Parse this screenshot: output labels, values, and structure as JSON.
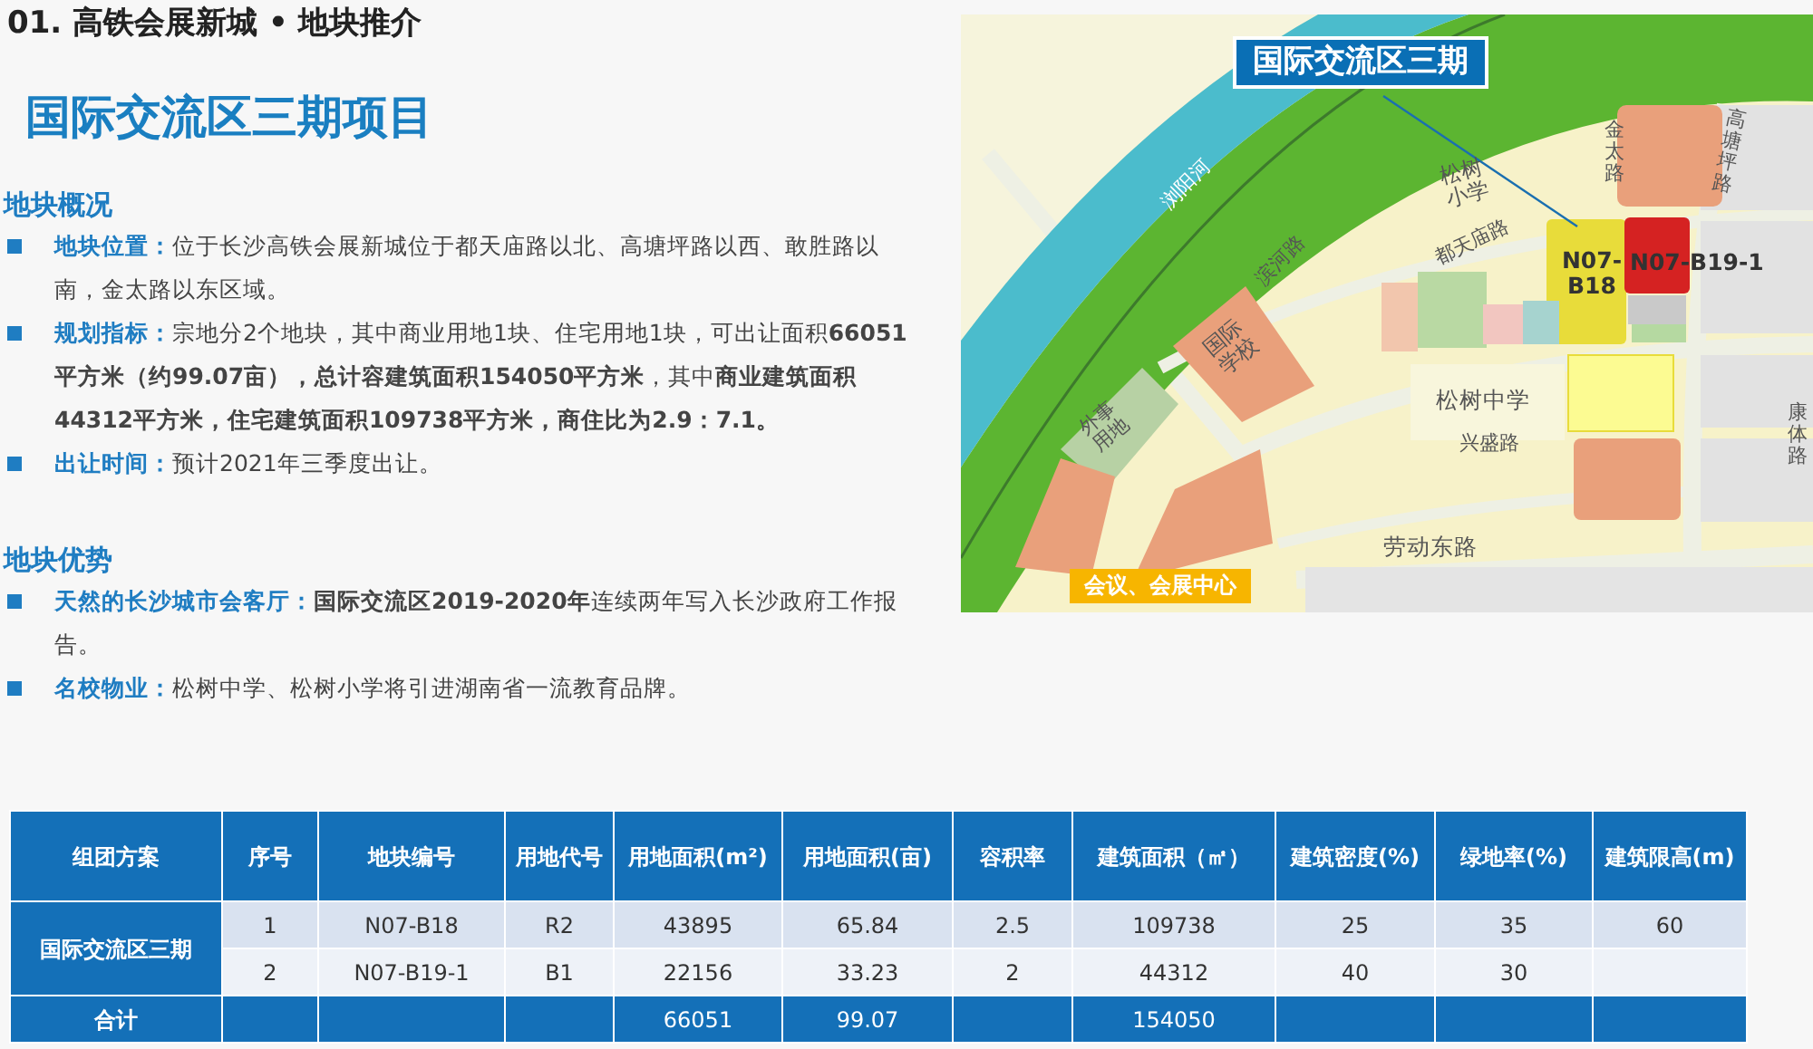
{
  "header": {
    "section_title": "01. 高铁会展新城 • 地块推介",
    "project_title": "国际交流区三期项目"
  },
  "overview": {
    "heading": "地块概况",
    "items": [
      {
        "label": "地块位置：",
        "text": "位于长沙高铁会展新城位于都天庙路以北、高塘坪路以西、敢胜路以南，金太路以东区域。"
      },
      {
        "label": "规划指标：",
        "text": "宗地分2个地块，其中商业用地1块、住宅用地1块，可出让面积**66051平方米（约99.07亩），总计容建筑面积154050平方米**，其中**商业建筑面积44312平方米，住宅建筑面积109738平方米，商住比为2.9：7.1。**"
      },
      {
        "label": "出让时间：",
        "text": "预计2021年三季度出让。"
      }
    ]
  },
  "advantages": {
    "heading": "地块优势",
    "items": [
      {
        "label": "天然的长沙城市会客厅：",
        "text": "**国际交流区2019-2020年**连续两年写入长沙政府工作报告。"
      },
      {
        "label": "名校物业：",
        "text": "松树中学、松树小学将引进湖南省一流教育品牌。"
      }
    ]
  },
  "map": {
    "labels": [
      {
        "kind": "river",
        "text": "浏阳河"
      },
      {
        "kind": "road",
        "text": "滨河路"
      },
      {
        "kind": "place",
        "text": "松树小学"
      },
      {
        "kind": "road",
        "text": "都天庙路"
      },
      {
        "kind": "road",
        "text": "金太路"
      },
      {
        "kind": "road",
        "text": "高塘坪路"
      },
      {
        "kind": "plot",
        "text": "N07-B18"
      },
      {
        "kind": "plot",
        "text": "N07-B19-1"
      },
      {
        "kind": "place",
        "text": "国际学校"
      },
      {
        "kind": "place",
        "text": "外事用地"
      },
      {
        "kind": "place",
        "text": "松树中学"
      },
      {
        "kind": "road",
        "text": "兴盛路"
      },
      {
        "kind": "road",
        "text": "劳动东路"
      },
      {
        "kind": "road",
        "text": "康体路"
      },
      {
        "kind": "callout",
        "text": "国际交流区三期"
      },
      {
        "kind": "tag",
        "text": "会议、会展中心"
      }
    ]
  },
  "table": {
    "columns": [
      "组团方案",
      "序号",
      "地块编号",
      "用地代号",
      "用地面积(m²)",
      "用地面积(亩)",
      "容积率",
      "建筑面积（㎡）",
      "建筑密度(%)",
      "绿地率(%)",
      "建筑限高(m)"
    ],
    "rows": [
      [
        {
          "text": "国际交流区三期",
          "rowspan": 2
        },
        "1",
        "N07-B18",
        "R2",
        "43895",
        "65.84",
        "2.5",
        "109738",
        "25",
        "35",
        "60"
      ],
      [
        "2",
        "N07-B19-1",
        "B1",
        "22156",
        "33.23",
        "2",
        "44312",
        "40",
        "30",
        ""
      ],
      [
        "合计",
        "",
        "",
        "",
        "66051",
        "99.07",
        "",
        "154050",
        "",
        "",
        ""
      ]
    ]
  }
}
